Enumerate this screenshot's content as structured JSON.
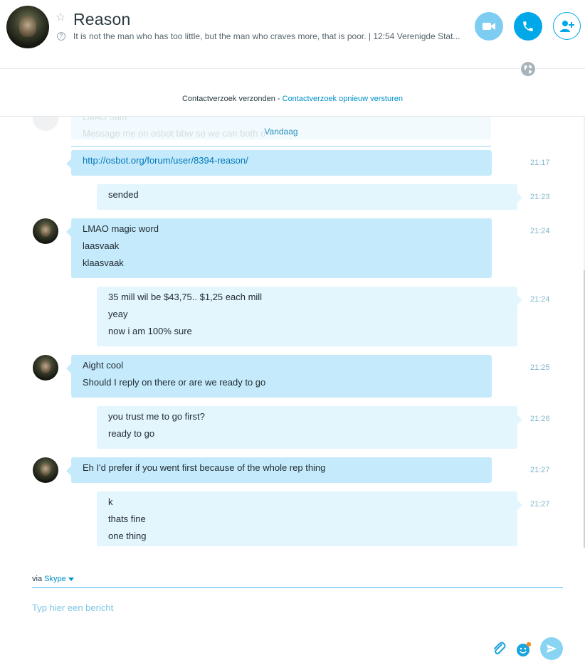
{
  "header": {
    "contact_name": "Reason",
    "mood": "It is not the man who has too little, but the man who craves more, that is poor.  | 12:54 Verenigde Stat...",
    "buttons": [
      "video-call",
      "audio-call",
      "add-participant"
    ]
  },
  "contact_request": {
    "text": "Contactverzoek verzonden",
    "separator": " - ",
    "link": "Contactverzoek opnieuw versturen"
  },
  "conversation": {
    "faded_preview": {
      "sender": "LMAO Sam",
      "message": "Message me on osbot bbw so we can both o"
    },
    "date_separator": "Vandaag",
    "messages": [
      {
        "direction": "in",
        "avatar": false,
        "time": "21:17",
        "lines": [
          "http://osbot.org/forum/user/8394-reason/"
        ],
        "link": true
      },
      {
        "direction": "out",
        "avatar": false,
        "time": "21:23",
        "lines": [
          "sended"
        ]
      },
      {
        "direction": "in",
        "avatar": true,
        "time": "21:24",
        "lines": [
          "LMAO magic word",
          "laasvaak",
          "klaasvaak"
        ]
      },
      {
        "direction": "out",
        "avatar": false,
        "time": "21:24",
        "lines": [
          "35 mill wil be $43,75.. $1,25 each mill",
          "yeay",
          "now i am 100% sure"
        ]
      },
      {
        "direction": "in",
        "avatar": true,
        "time": "21:25",
        "lines": [
          "Aight cool",
          "Should I reply on there or are we ready to go"
        ]
      },
      {
        "direction": "out",
        "avatar": false,
        "time": "21:26",
        "lines": [
          "you trust me to go first?",
          "ready to go"
        ]
      },
      {
        "direction": "in",
        "avatar": true,
        "time": "21:27",
        "lines": [
          "Eh I'd prefer if you went first because of the whole rep thing"
        ]
      },
      {
        "direction": "out",
        "avatar": false,
        "time": "21:27",
        "lines": [
          "k",
          "thats fine",
          "one thing"
        ]
      }
    ]
  },
  "composer": {
    "via_label": "via",
    "via_service": "Skype",
    "placeholder": "Typ hier een bericht",
    "value": ""
  },
  "colors": {
    "accent": "#00a8e8",
    "incoming_bubble": "#c5eafb",
    "outgoing_bubble": "#e3f5fd",
    "timestamp": "#7fb5cc"
  },
  "icons": [
    "star-icon",
    "mood-info-icon",
    "video-icon",
    "phone-icon",
    "add-contact-icon",
    "globe-icon",
    "paperclip-icon",
    "emoji-icon",
    "send-icon"
  ]
}
